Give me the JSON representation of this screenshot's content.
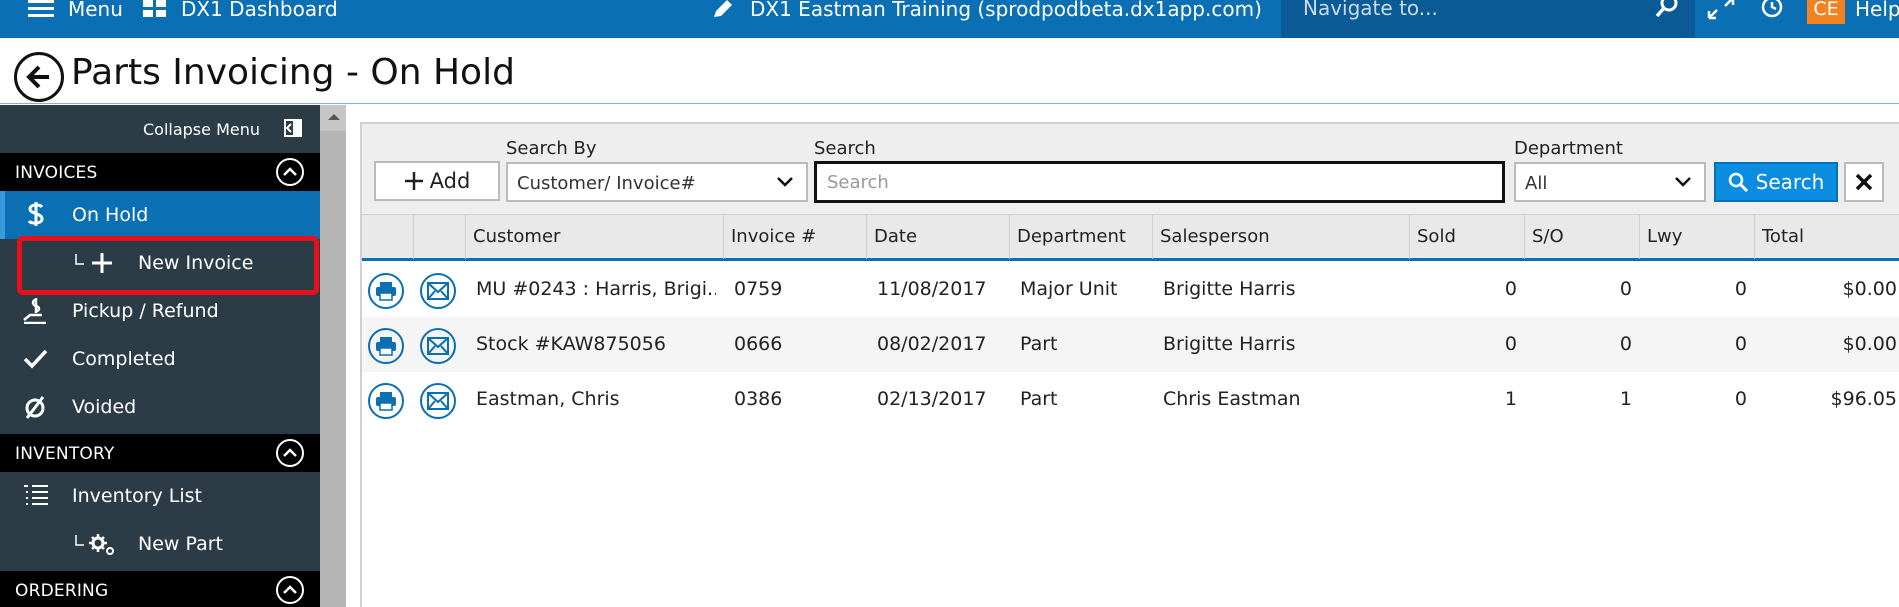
{
  "topbar": {
    "menu_label": "Menu",
    "dashboard_label": "DX1 Dashboard",
    "account_label": "DX1 Eastman Training (sprodpodbeta.dx1app.com)",
    "navigate_placeholder": "Navigate to...",
    "user_initials": "CE",
    "help_label": "Help",
    "accent_color": "#0a6fb3",
    "badge_color": "#f58220"
  },
  "page": {
    "title": "Parts Invoicing - On Hold"
  },
  "sidebar": {
    "collapse_label": "Collapse Menu",
    "sections": [
      {
        "label": "INVOICES"
      },
      {
        "label": "INVENTORY"
      },
      {
        "label": "ORDERING"
      }
    ],
    "invoices_items": [
      {
        "label": "On Hold",
        "icon": "dollar-icon"
      },
      {
        "label": "New Invoice",
        "icon": "plus-icon"
      },
      {
        "label": "Pickup / Refund",
        "icon": "pickup-icon"
      },
      {
        "label": "Completed",
        "icon": "check-icon"
      },
      {
        "label": "Voided",
        "icon": "void-icon"
      }
    ],
    "inventory_items": [
      {
        "label": "Inventory List",
        "icon": "list-icon"
      },
      {
        "label": "New Part",
        "icon": "gear-icon"
      }
    ]
  },
  "toolbar": {
    "add_label": "Add",
    "search_by_label": "Search By",
    "search_by_value": "Customer/ Invoice#",
    "search_label": "Search",
    "search_placeholder": "Search",
    "department_label": "Department",
    "department_value": "All",
    "search_button": "Search"
  },
  "table": {
    "columns": [
      "Customer",
      "Invoice #",
      "Date",
      "Department",
      "Salesperson",
      "Sold",
      "S/O",
      "Lwy",
      "Total"
    ],
    "rows": [
      {
        "customer": "MU #0243 : Harris, Brigi...",
        "invoice": "0759",
        "date": "11/08/2017",
        "department": "Major Unit",
        "salesperson": "Brigitte Harris",
        "sold": "0",
        "so": "0",
        "lwy": "0",
        "total": "$0.00"
      },
      {
        "customer": "Stock #KAW875056",
        "invoice": "0666",
        "date": "08/02/2017",
        "department": "Part",
        "salesperson": "Brigitte Harris",
        "sold": "0",
        "so": "0",
        "lwy": "0",
        "total": "$0.00"
      },
      {
        "customer": "Eastman, Chris",
        "invoice": "0386",
        "date": "02/13/2017",
        "department": "Part",
        "salesperson": "Chris Eastman",
        "sold": "1",
        "so": "1",
        "lwy": "0",
        "total": "$96.05"
      }
    ]
  }
}
